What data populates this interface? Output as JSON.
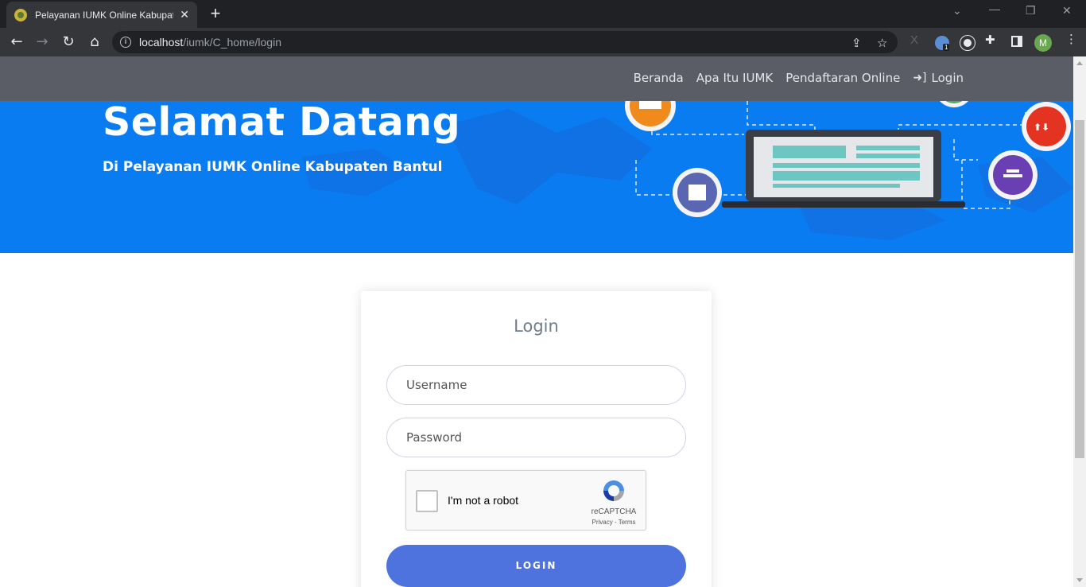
{
  "browser": {
    "tab_title": "Pelayanan IUMK Online Kabupaten Bantul",
    "tab_close": "✕",
    "new_tab": "+",
    "url_host": "localhost",
    "url_path": "/iumk/C_home/login",
    "avatar_initial": "M",
    "extension_badge": "1"
  },
  "navbar": {
    "links": [
      {
        "label": "Beranda"
      },
      {
        "label": "Apa Itu IUMK"
      },
      {
        "label": "Pendaftaran Online"
      },
      {
        "label": "Login",
        "icon": "sign-in-icon"
      }
    ]
  },
  "hero": {
    "title": "Selamat Datang",
    "subtitle": "Di Pelayanan IUMK Online Kabupaten Bantul",
    "background": "#0a7cf2"
  },
  "login_form": {
    "title": "Login",
    "username_placeholder": "Username",
    "password_placeholder": "Password",
    "captcha_label": "I'm not a robot",
    "captcha_brand": "reCAPTCHA",
    "captcha_links": "Privacy - Terms",
    "submit_label": "LOGIN",
    "accent": "#4e73df"
  }
}
